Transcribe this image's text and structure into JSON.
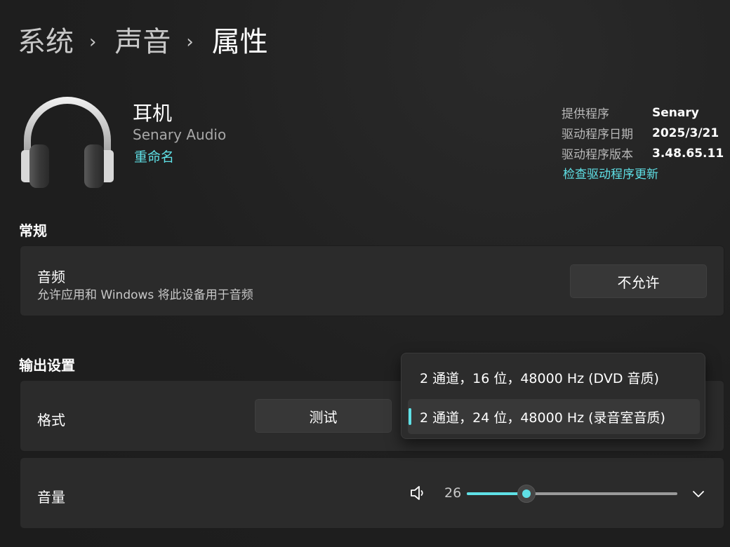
{
  "breadcrumb": {
    "items": [
      "系统",
      "声音",
      "属性"
    ],
    "separator": "›"
  },
  "device": {
    "name": "耳机",
    "manufacturer": "Senary Audio",
    "rename_link": "重命名",
    "icon": "headphones-icon"
  },
  "driver_info": {
    "rows": [
      {
        "label": "提供程序",
        "value": "Senary"
      },
      {
        "label": "驱动程序日期",
        "value": "2025/3/21"
      },
      {
        "label": "驱动程序版本",
        "value": "3.48.65.11"
      }
    ],
    "check_update_link": "检查驱动程序更新"
  },
  "general": {
    "section_title": "常规",
    "audio": {
      "title": "音频",
      "description": "允许应用和 Windows 将此设备用于音频",
      "button_label": "不允许"
    }
  },
  "output": {
    "section_title": "输出设置",
    "format": {
      "title": "格式",
      "test_button": "测试",
      "options": [
        "2 通道，16 位，48000 Hz (DVD 音质)",
        "2 通道，24 位，48000 Hz (录音室音质)"
      ],
      "selected_index": 1
    },
    "volume": {
      "title": "音量",
      "value": "26",
      "level": 0.26,
      "icon": "speaker-icon",
      "expand_icon": "chevron-down-icon"
    }
  },
  "colors": {
    "accent": "#5fe0e6",
    "background": "#202020",
    "card": "#2b2b2b"
  }
}
